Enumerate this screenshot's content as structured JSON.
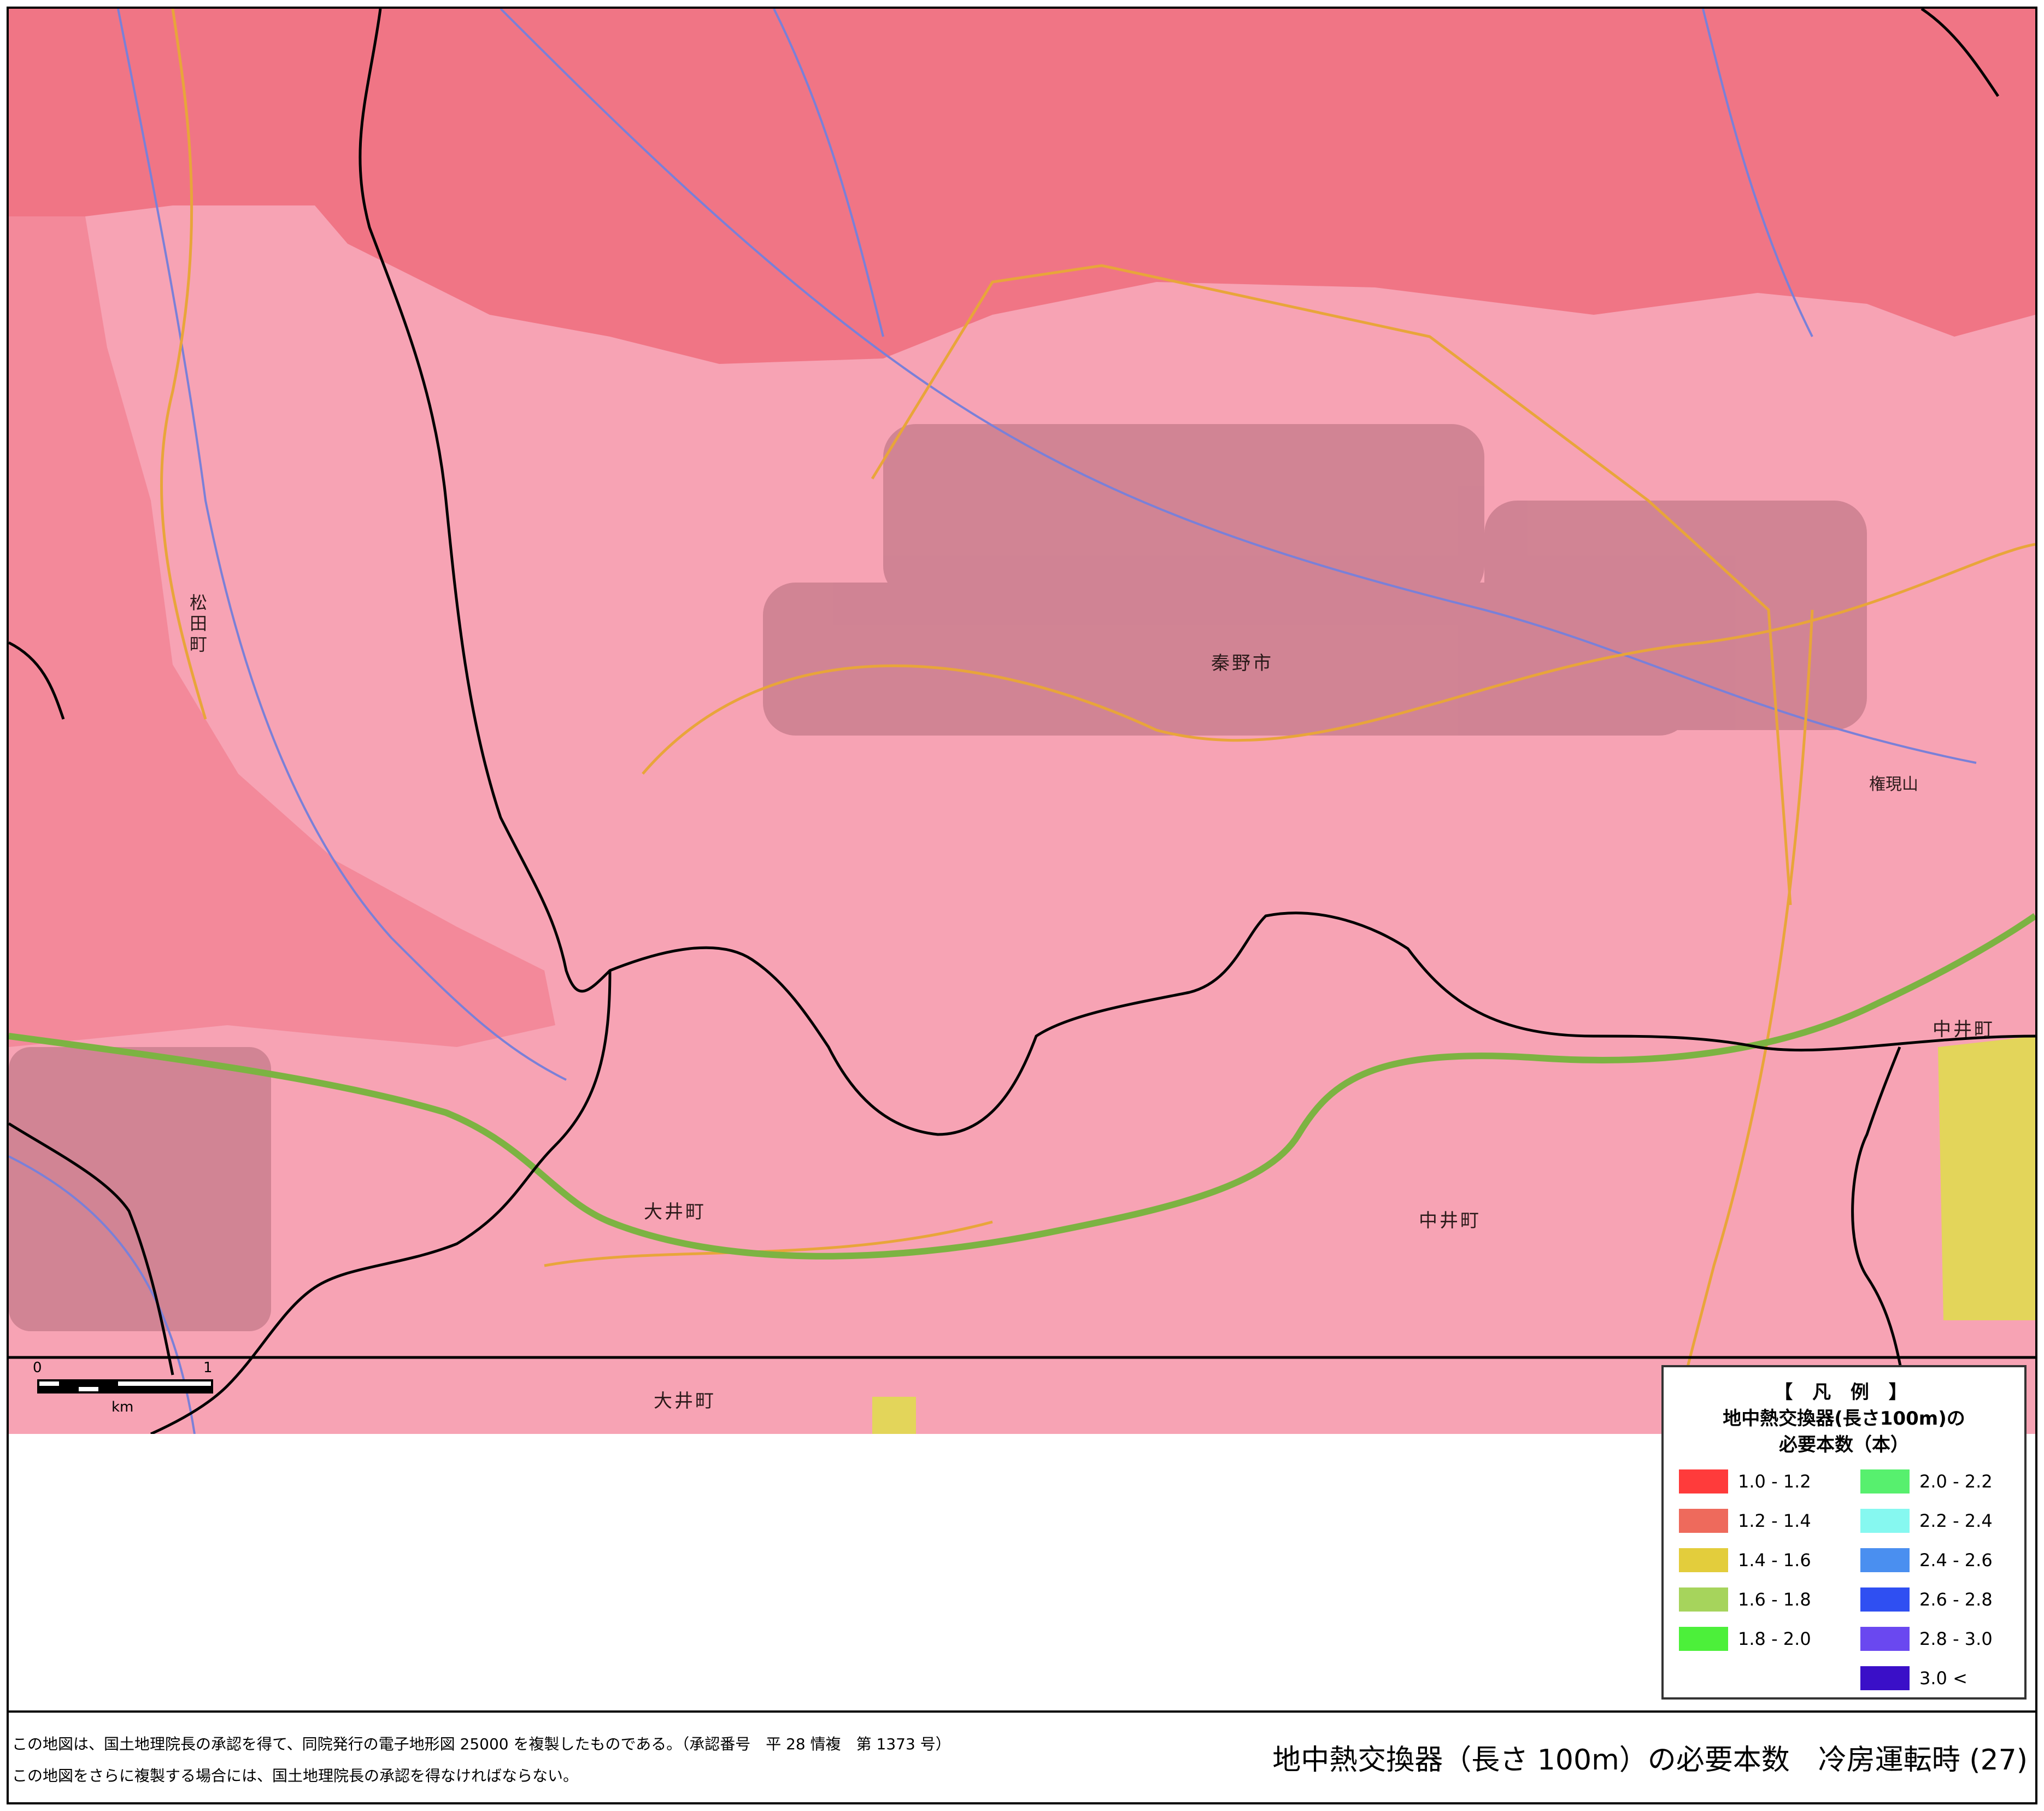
{
  "map": {
    "place_labels": [
      {
        "id": "hadano-shi",
        "text": "秦野市"
      },
      {
        "id": "matsuda-machi",
        "text": "松田町"
      },
      {
        "id": "oi-machi-1",
        "text": "大井町"
      },
      {
        "id": "oi-machi-2",
        "text": "大井町"
      },
      {
        "id": "nakai-machi-1",
        "text": "中井町"
      },
      {
        "id": "nakai-machi-2",
        "text": "中井町"
      },
      {
        "id": "gongen-yama",
        "text": "権現山"
      }
    ],
    "colors": {
      "zone_red": "#f07585",
      "zone_pink": "#f7a3b4",
      "zone_yellow": "#e3d55a",
      "expressway": "#7cb342",
      "boundary": "#000000",
      "river": "#7a80d8",
      "road": "#e8a53a"
    }
  },
  "scale": {
    "zero": "0",
    "one": "1",
    "unit": "km"
  },
  "legend": {
    "title": "【 凡 例 】",
    "subtitle_1": "地中熱交換器(長さ100m)の",
    "subtitle_2": "必要本数（本）",
    "items": [
      {
        "label": "1.0 - 1.2",
        "color": "#ff3b3b"
      },
      {
        "label": "1.2 - 1.4",
        "color": "#ee6a5c"
      },
      {
        "label": "1.4 - 1.6",
        "color": "#e3cd3c"
      },
      {
        "label": "1.6 - 1.8",
        "color": "#a6d45c"
      },
      {
        "label": "1.8 - 2.0",
        "color": "#4cf03a"
      },
      {
        "label": "2.0 - 2.2",
        "color": "#57f06e"
      },
      {
        "label": "2.2 - 2.4",
        "color": "#86f8f0"
      },
      {
        "label": "2.4 - 2.6",
        "color": "#4a8ff0"
      },
      {
        "label": "2.6 - 2.8",
        "color": "#2f4ff2"
      },
      {
        "label": "2.8 - 3.0",
        "color": "#6a48f0"
      },
      {
        "label": "3.0 <",
        "color": "#3a0fc8"
      }
    ]
  },
  "footer": {
    "credit_line_1": "この地図は、国土地理院長の承認を得て、同院発行の電子地形図 25000 を複製したものである。（承認番号　平 28 情複　第 1373 号）",
    "credit_line_2": "この地図をさらに複製する場合には、国土地理院長の承認を得なければならない。",
    "title": "地中熱交換器（長さ 100m）の必要本数　冷房運転時 (27)"
  }
}
